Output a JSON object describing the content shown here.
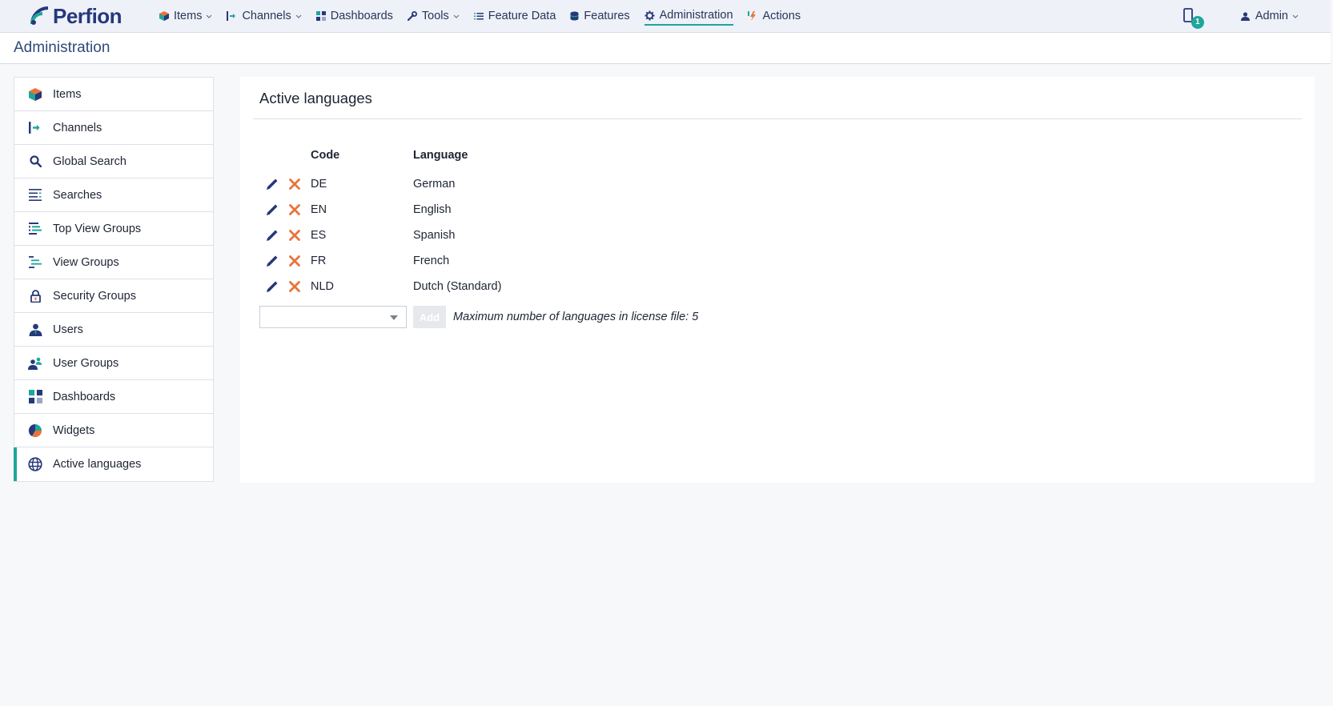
{
  "brand": {
    "name": "Perfion"
  },
  "nav": {
    "items": [
      {
        "label": "Items",
        "icon": "cube-icon",
        "dropdown": true
      },
      {
        "label": "Channels",
        "icon": "channel-icon",
        "dropdown": true
      },
      {
        "label": "Dashboards",
        "icon": "dashboard-icon",
        "dropdown": false
      },
      {
        "label": "Tools",
        "icon": "wrench-icon",
        "dropdown": true
      },
      {
        "label": "Feature Data",
        "icon": "list-icon",
        "dropdown": false
      },
      {
        "label": "Features",
        "icon": "database-icon",
        "dropdown": false
      },
      {
        "label": "Administration",
        "icon": "gear-icon",
        "dropdown": false,
        "active": true
      },
      {
        "label": "Actions",
        "icon": "lightning-icon",
        "dropdown": false
      }
    ],
    "notifications_count": "1",
    "user_label": "Admin"
  },
  "page": {
    "title": "Administration"
  },
  "sidebar": {
    "items": [
      {
        "label": "Items",
        "icon": "cube-icon"
      },
      {
        "label": "Channels",
        "icon": "channel-icon"
      },
      {
        "label": "Global Search",
        "icon": "search-icon"
      },
      {
        "label": "Searches",
        "icon": "search-list-icon"
      },
      {
        "label": "Top View Groups",
        "icon": "top-view-groups-icon"
      },
      {
        "label": "View Groups",
        "icon": "view-groups-icon"
      },
      {
        "label": "Security Groups",
        "icon": "lock-icon"
      },
      {
        "label": "Users",
        "icon": "user-icon"
      },
      {
        "label": "User Groups",
        "icon": "user-groups-icon"
      },
      {
        "label": "Dashboards",
        "icon": "dashboard-icon"
      },
      {
        "label": "Widgets",
        "icon": "pie-chart-icon"
      },
      {
        "label": "Active languages",
        "icon": "globe-icon",
        "active": true
      }
    ]
  },
  "main": {
    "title": "Active languages",
    "columns": {
      "code": "Code",
      "language": "Language"
    },
    "rows": [
      {
        "code": "DE",
        "language": "German"
      },
      {
        "code": "EN",
        "language": "English"
      },
      {
        "code": "ES",
        "language": "Spanish"
      },
      {
        "code": "FR",
        "language": "French"
      },
      {
        "code": "NLD",
        "language": "Dutch (Standard)"
      }
    ],
    "select_value": "",
    "add_label": "Add",
    "license_note": "Maximum number of languages in license file: 5"
  },
  "colors": {
    "accent": "#1fa69a",
    "brand": "#26387a",
    "delete": "#e8743b",
    "edit": "#26387a"
  }
}
